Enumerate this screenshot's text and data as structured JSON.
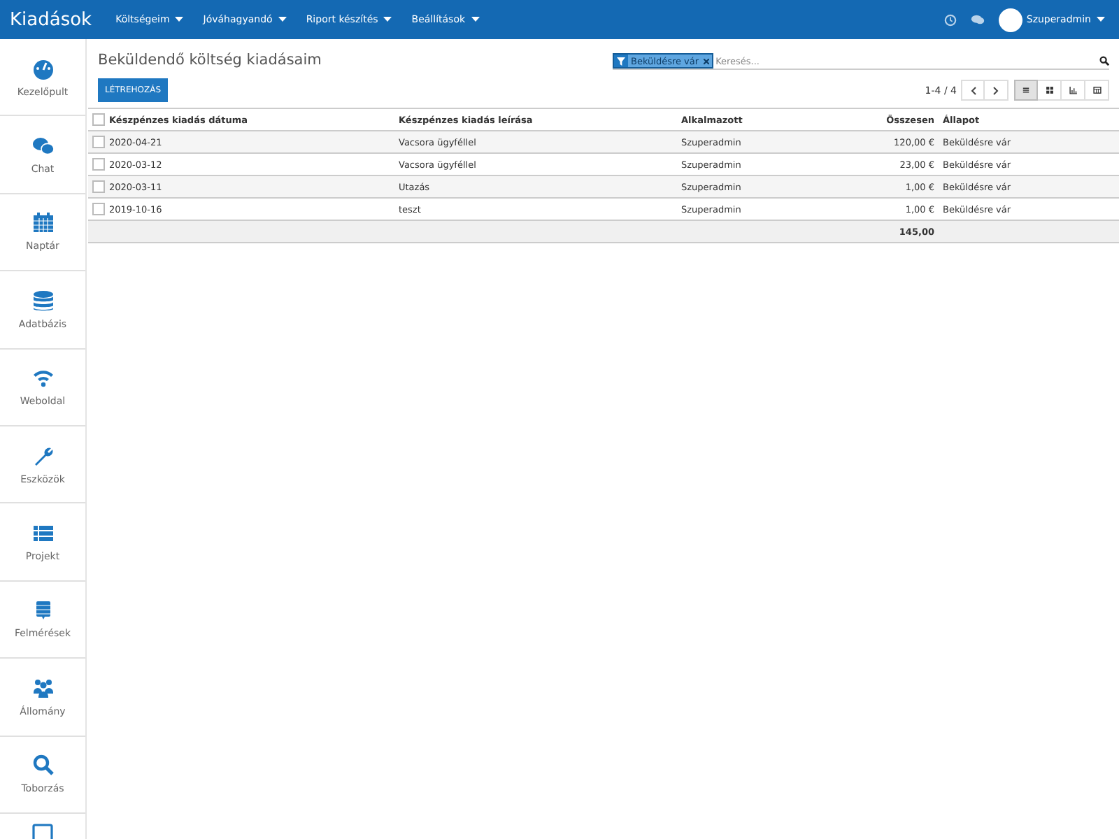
{
  "topbar": {
    "app_title": "Kiadások",
    "menus": [
      {
        "label": "Költségeim"
      },
      {
        "label": "Jóváhagyandó"
      },
      {
        "label": "Riport készítés"
      },
      {
        "label": "Beállítások"
      }
    ],
    "user": "Szuperadmin"
  },
  "sidebar": {
    "items": [
      {
        "label": "Kezelőpult"
      },
      {
        "label": "Chat"
      },
      {
        "label": "Naptár"
      },
      {
        "label": "Adatbázis"
      },
      {
        "label": "Weboldal"
      },
      {
        "label": "Eszközök"
      },
      {
        "label": "Projekt"
      },
      {
        "label": "Felmérések"
      },
      {
        "label": "Állomány"
      },
      {
        "label": "Toborzás"
      }
    ]
  },
  "page": {
    "title": "Beküldendő költség kiadásaim",
    "create_button": "LÉTREHOZÁS",
    "filter_tag": "Beküldésre vár",
    "search": {
      "placeholder": "Keresés..."
    },
    "pager": "1-4 / 4",
    "views": [
      {
        "selected": true
      },
      {
        "selected": false
      },
      {
        "selected": false
      },
      {
        "selected": false
      }
    ]
  },
  "table": {
    "columns": [
      "Készpénzes kiadás dátuma",
      "Készpénzes kiadás leírása",
      "Alkalmazott",
      "Összesen",
      "Állapot"
    ],
    "all_checked": false,
    "rows": [
      {
        "checked": false,
        "cells": [
          "2020-04-21",
          "Vacsora ügyféllel",
          "Szuperadmin",
          "120,00 €",
          "Beküldésre vár"
        ]
      },
      {
        "checked": false,
        "cells": [
          "2020-03-12",
          "Vacsora ügyféllel",
          "Szuperadmin",
          "23,00 €",
          "Beküldésre vár"
        ]
      },
      {
        "checked": false,
        "cells": [
          "2020-03-11",
          "Utazás",
          "Szuperadmin",
          "1,00 €",
          "Beküldésre vár"
        ]
      },
      {
        "checked": false,
        "cells": [
          "2019-10-16",
          "teszt",
          "Szuperadmin",
          "1,00 €",
          "Beküldésre vár"
        ]
      }
    ],
    "total": "145,00"
  }
}
